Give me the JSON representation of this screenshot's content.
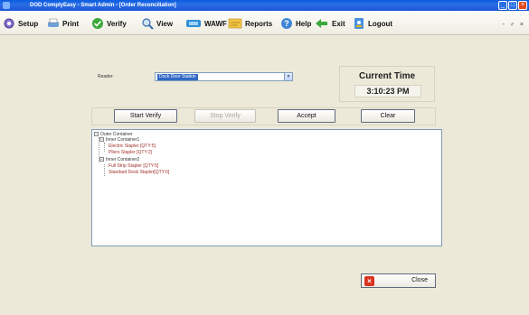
{
  "window": {
    "title": "DOD ComplyEasy - Smart Admin - [Order Reconciliation]",
    "controls": [
      "_",
      "□",
      "×"
    ],
    "mdi_controls": "- ♂ ×"
  },
  "toolbar": {
    "items": [
      {
        "label": "Setup",
        "icon": "setup-icon"
      },
      {
        "label": "Print",
        "icon": "print-icon"
      },
      {
        "label": "Verify",
        "icon": "verify-icon"
      },
      {
        "label": "View",
        "icon": "view-icon"
      },
      {
        "label": "WAWF",
        "icon": "wawf-icon"
      },
      {
        "label": "Reports",
        "icon": "reports-icon"
      },
      {
        "label": "Help",
        "icon": "help-icon"
      },
      {
        "label": "Exit",
        "icon": "exit-icon"
      },
      {
        "label": "Logout",
        "icon": "logout-icon"
      }
    ]
  },
  "reader": {
    "label": "Reader:",
    "selected": "Dock Door Station"
  },
  "current_time": {
    "title": "Current Time",
    "value": "3:10:23 PM"
  },
  "actions": {
    "start_verify": "Start Verify",
    "stop_verify": "Stop Verify",
    "accept": "Accept",
    "clear": "Clear"
  },
  "tree": {
    "root": "Outer Container",
    "groups": [
      {
        "label": "Inner Container1",
        "items": [
          "Electric Stapler [QTY:5]",
          "Pliers Stapler [QTY:2]"
        ]
      },
      {
        "label": "Inner Container2",
        "items": [
          "Full Strip Stapler [QTY:5]",
          "Standard Desk Stapler[QTY:6]"
        ]
      }
    ]
  },
  "close_button": {
    "label": "Close"
  }
}
